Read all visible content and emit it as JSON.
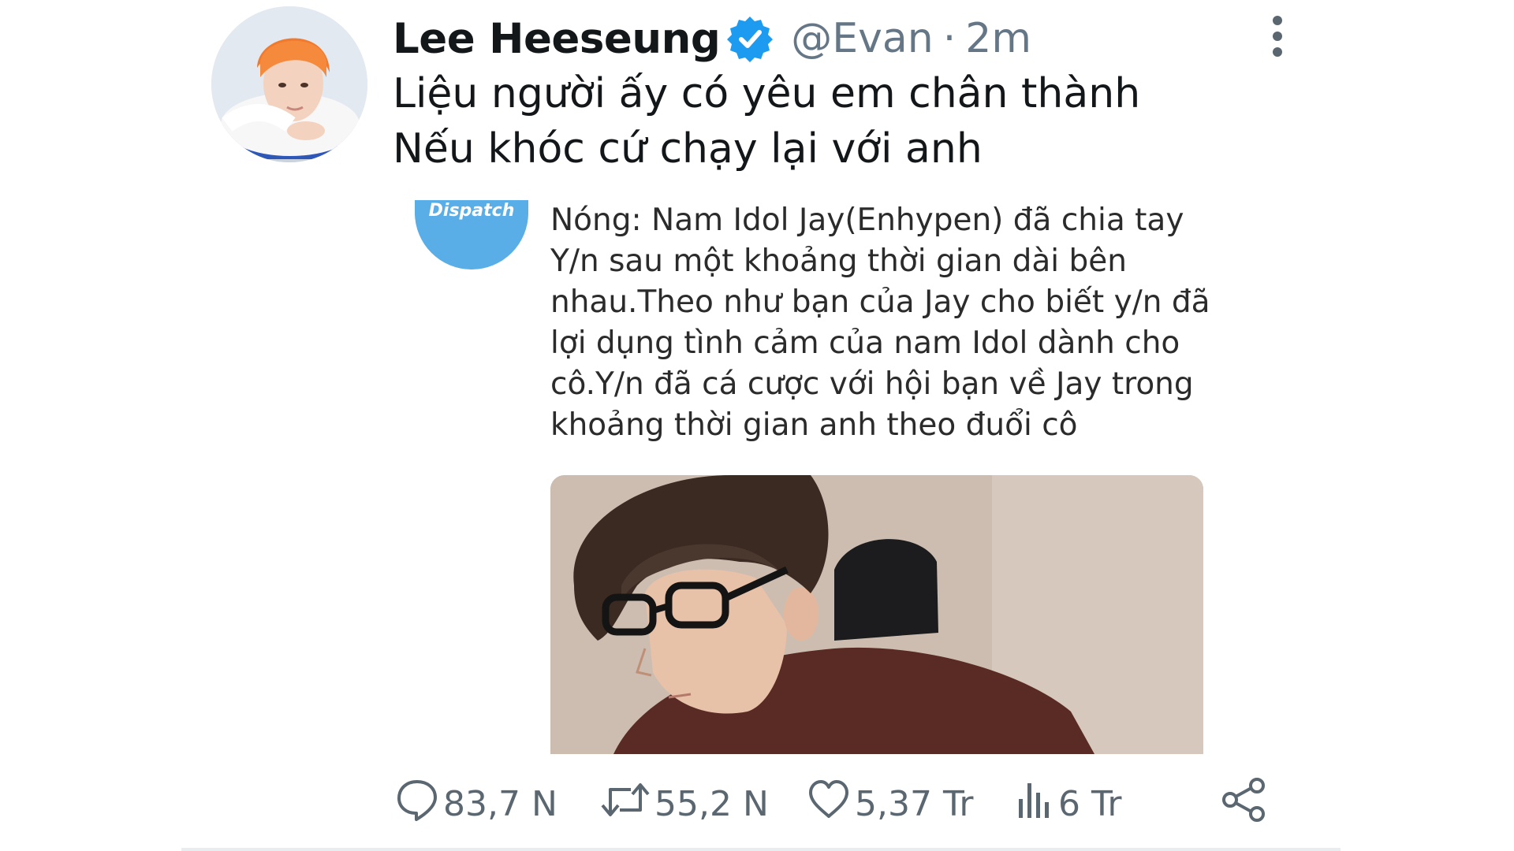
{
  "tweet": {
    "display_name": "Lee Heeseung",
    "handle": "@Evan",
    "separator": "·",
    "time": "2m",
    "lines": [
      "Liệu người ấy có yêu em chân thành",
      "Nếu khóc cứ chạy lại với anh"
    ]
  },
  "quote": {
    "avatar_label": "Dispatch",
    "lines": [
      "Nóng: Nam Idol Jay(Enhypen) đã chia tay",
      "Y/n sau một khoảng thời gian dài bên",
      "nhau.Theo như bạn của Jay cho biết y/n đã",
      "lợi dụng tình cảm của nam Idol dành cho",
      "cô.Y/n đã cá cược với hội bạn về Jay trong",
      "khoảng thời gian anh theo đuổi cô"
    ]
  },
  "actions": {
    "replies": "83,7 N",
    "retweets": "55,2 N",
    "likes": "5,37 Tr",
    "views": "6 Tr"
  },
  "icons": {
    "verified": "verified-badge-icon",
    "more": "more-vertical-icon",
    "reply": "reply-icon",
    "retweet": "retweet-icon",
    "like": "heart-icon",
    "views": "views-icon",
    "share": "share-icon"
  },
  "colors": {
    "verified_blue": "#1d9bf0",
    "muted_text": "#657786",
    "dispatch_blue": "#5aaee8"
  }
}
